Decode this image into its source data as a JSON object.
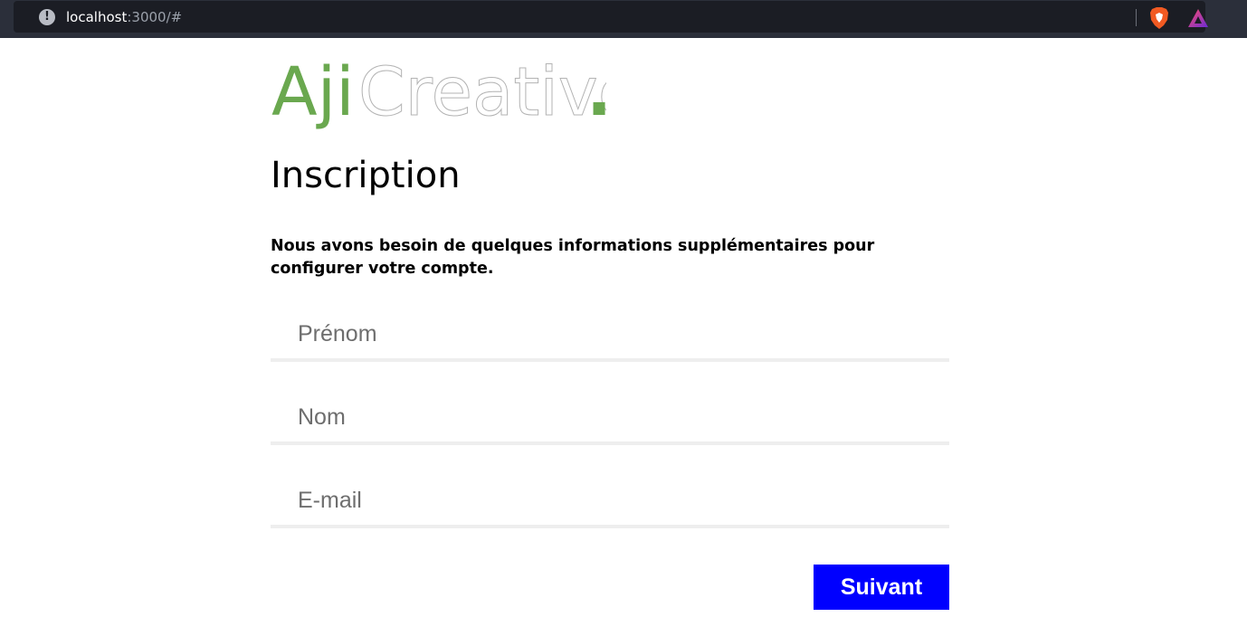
{
  "browser": {
    "url_host": "localhost",
    "url_path": ":3000/#",
    "info_icon": "info-icon",
    "extensions": [
      "brave-shields-icon",
      "brave-rewards-icon"
    ]
  },
  "brand": {
    "logo_text_accent": "Aji",
    "logo_text_main": "Creative",
    "logo_dot": ".",
    "accent_color": "#6aa84f"
  },
  "form": {
    "title": "Inscription",
    "subtitle": "Nous avons besoin de quelques informations supplémentaires pour configurer votre compte.",
    "fields": [
      {
        "placeholder": "Prénom",
        "value": ""
      },
      {
        "placeholder": "Nom",
        "value": ""
      },
      {
        "placeholder": "E-mail",
        "value": ""
      }
    ],
    "submit_label": "Suivant",
    "submit_color": "#0000ff"
  }
}
